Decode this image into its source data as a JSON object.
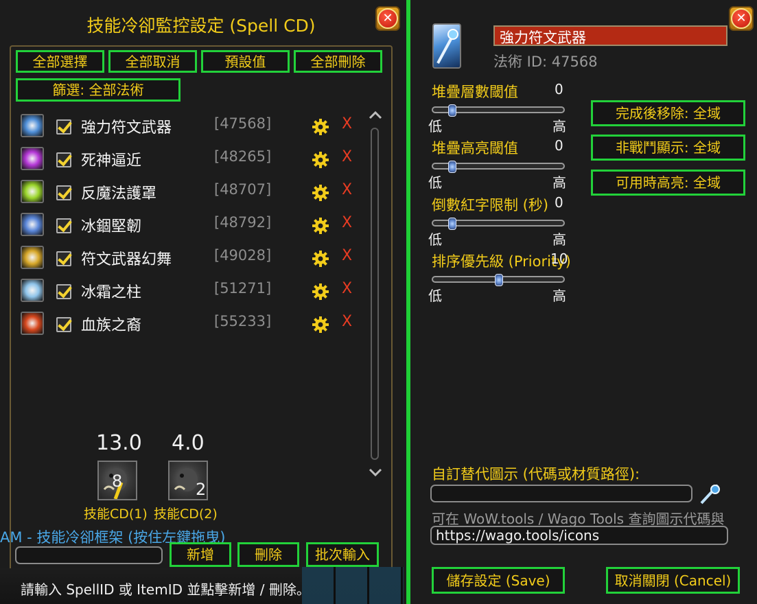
{
  "left": {
    "title": "技能冷卻監控設定 (Spell CD)",
    "buttons": {
      "select_all": "全部選擇",
      "deselect_all": "全部取消",
      "defaults": "預設值",
      "delete_all": "全部刪除",
      "filter": "篩選: 全部法術"
    },
    "spells": [
      {
        "name": "強力符文武器",
        "id": "[47568]",
        "icon": "runic-weapon-icon",
        "color": "#4f8fd8"
      },
      {
        "name": "死神逼近",
        "id": "[48265]",
        "icon": "death-skull-icon",
        "color": "#b639d8"
      },
      {
        "name": "反魔法護罩",
        "id": "[48707]",
        "icon": "anti-magic-shell-icon",
        "color": "#9bd62c"
      },
      {
        "name": "冰錮堅韌",
        "id": "[48792]",
        "icon": "icebound-fortitude-icon",
        "color": "#5a86d8"
      },
      {
        "name": "符文武器幻舞",
        "id": "[49028]",
        "icon": "dancing-rune-weapon-icon",
        "color": "#d8a82a"
      },
      {
        "name": "冰霜之柱",
        "id": "[51271]",
        "icon": "pillar-of-frost-icon",
        "color": "#8fc4ea"
      },
      {
        "name": "血族之裔",
        "id": "[55233]",
        "icon": "vampiric-blood-icon",
        "color": "#d8491f"
      }
    ],
    "delete_glyph": "X",
    "cd_previews": [
      {
        "timer": "13.0",
        "count": "8",
        "label": "技能CD(1)"
      },
      {
        "timer": "4.0",
        "count": "2",
        "label": "技能CD(2)"
      }
    ],
    "frame_label": "AM - 技能冷卻框架 (按住左鍵拖曳)",
    "input_value": "",
    "add_button": "新增",
    "delete_button": "刪除",
    "batch_button": "批次輸入",
    "hint": "請輸入 SpellID 或 ItemID 並點擊新增 / 刪除。"
  },
  "right": {
    "spell_name": "強力符文武器",
    "spell_id_label": "法術 ID: 47568",
    "sliders": [
      {
        "label": "堆疊層數閾值",
        "value": "0",
        "low": "低",
        "high": "高",
        "fraction": 0.12
      },
      {
        "label": "堆疊高亮閾值",
        "value": "0",
        "low": "低",
        "high": "高",
        "fraction": 0.12
      },
      {
        "label": "倒數紅字限制 (秒)",
        "value": "0",
        "low": "低",
        "high": "高",
        "fraction": 0.12
      },
      {
        "label": "排序優先級 (Priority)",
        "value": "10",
        "low": "低",
        "high": "高",
        "fraction": 0.5
      }
    ],
    "toggles": {
      "remove_after": "完成後移除: 全域",
      "out_of_combat": "非戰鬥顯示: 全域",
      "highlight_usable": "可用時高亮: 全域"
    },
    "custom_icon_label": "自訂替代圖示 (代碼或材質路徑):",
    "custom_icon_value": "",
    "tools_hint": "可在 WoW.tools / Wago Tools 查詢圖示代碼與",
    "url_value": "https://wago.tools/icons",
    "save_button": "儲存設定 (Save)",
    "cancel_button": "取消關閉 (Cancel)"
  },
  "colors": {
    "button_border": "#22d13a",
    "gold": "#f2cc1a",
    "delete_red": "#e83c23",
    "name_bar": "#b42a14"
  }
}
